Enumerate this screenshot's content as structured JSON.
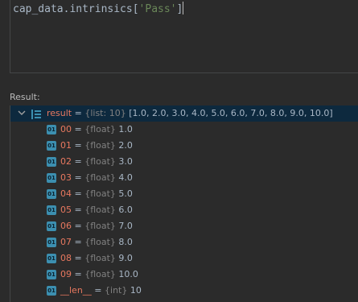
{
  "editor": {
    "code_prefix": "cap_data.intrinsics[",
    "code_string": "'Pass'",
    "code_suffix": "]"
  },
  "result_label": "Result:",
  "tree": {
    "root": {
      "name": "result",
      "eq": " = ",
      "type": "{list: 10}",
      "value": " [1.0, 2.0, 3.0, 4.0, 5.0, 6.0, 7.0, 8.0, 9.0, 10.0]",
      "expander": "chevron-down-icon",
      "icon": "list-icon"
    },
    "items": [
      {
        "icon_text": "01",
        "name": "00",
        "eq": " = ",
        "type": "{float}",
        "value": " 1.0"
      },
      {
        "icon_text": "01",
        "name": "01",
        "eq": " = ",
        "type": "{float}",
        "value": " 2.0"
      },
      {
        "icon_text": "01",
        "name": "02",
        "eq": " = ",
        "type": "{float}",
        "value": " 3.0"
      },
      {
        "icon_text": "01",
        "name": "03",
        "eq": " = ",
        "type": "{float}",
        "value": " 4.0"
      },
      {
        "icon_text": "01",
        "name": "04",
        "eq": " = ",
        "type": "{float}",
        "value": " 5.0"
      },
      {
        "icon_text": "01",
        "name": "05",
        "eq": " = ",
        "type": "{float}",
        "value": " 6.0"
      },
      {
        "icon_text": "01",
        "name": "06",
        "eq": " = ",
        "type": "{float}",
        "value": " 7.0"
      },
      {
        "icon_text": "01",
        "name": "07",
        "eq": " = ",
        "type": "{float}",
        "value": " 8.0"
      },
      {
        "icon_text": "01",
        "name": "08",
        "eq": " = ",
        "type": "{float}",
        "value": " 9.0"
      },
      {
        "icon_text": "01",
        "name": "09",
        "eq": " = ",
        "type": "{float}",
        "value": " 10.0"
      },
      {
        "icon_text": "01",
        "name": "__len__",
        "eq": " = ",
        "type": "{int}",
        "value": " 10"
      }
    ]
  },
  "colors": {
    "background": "#2b2b2b",
    "selected_row": "#0d293e",
    "name": "#e8785f",
    "type": "#808080",
    "value": "#a9b7c6",
    "string": "#6a8759",
    "var_icon": "#3c8fb0"
  }
}
